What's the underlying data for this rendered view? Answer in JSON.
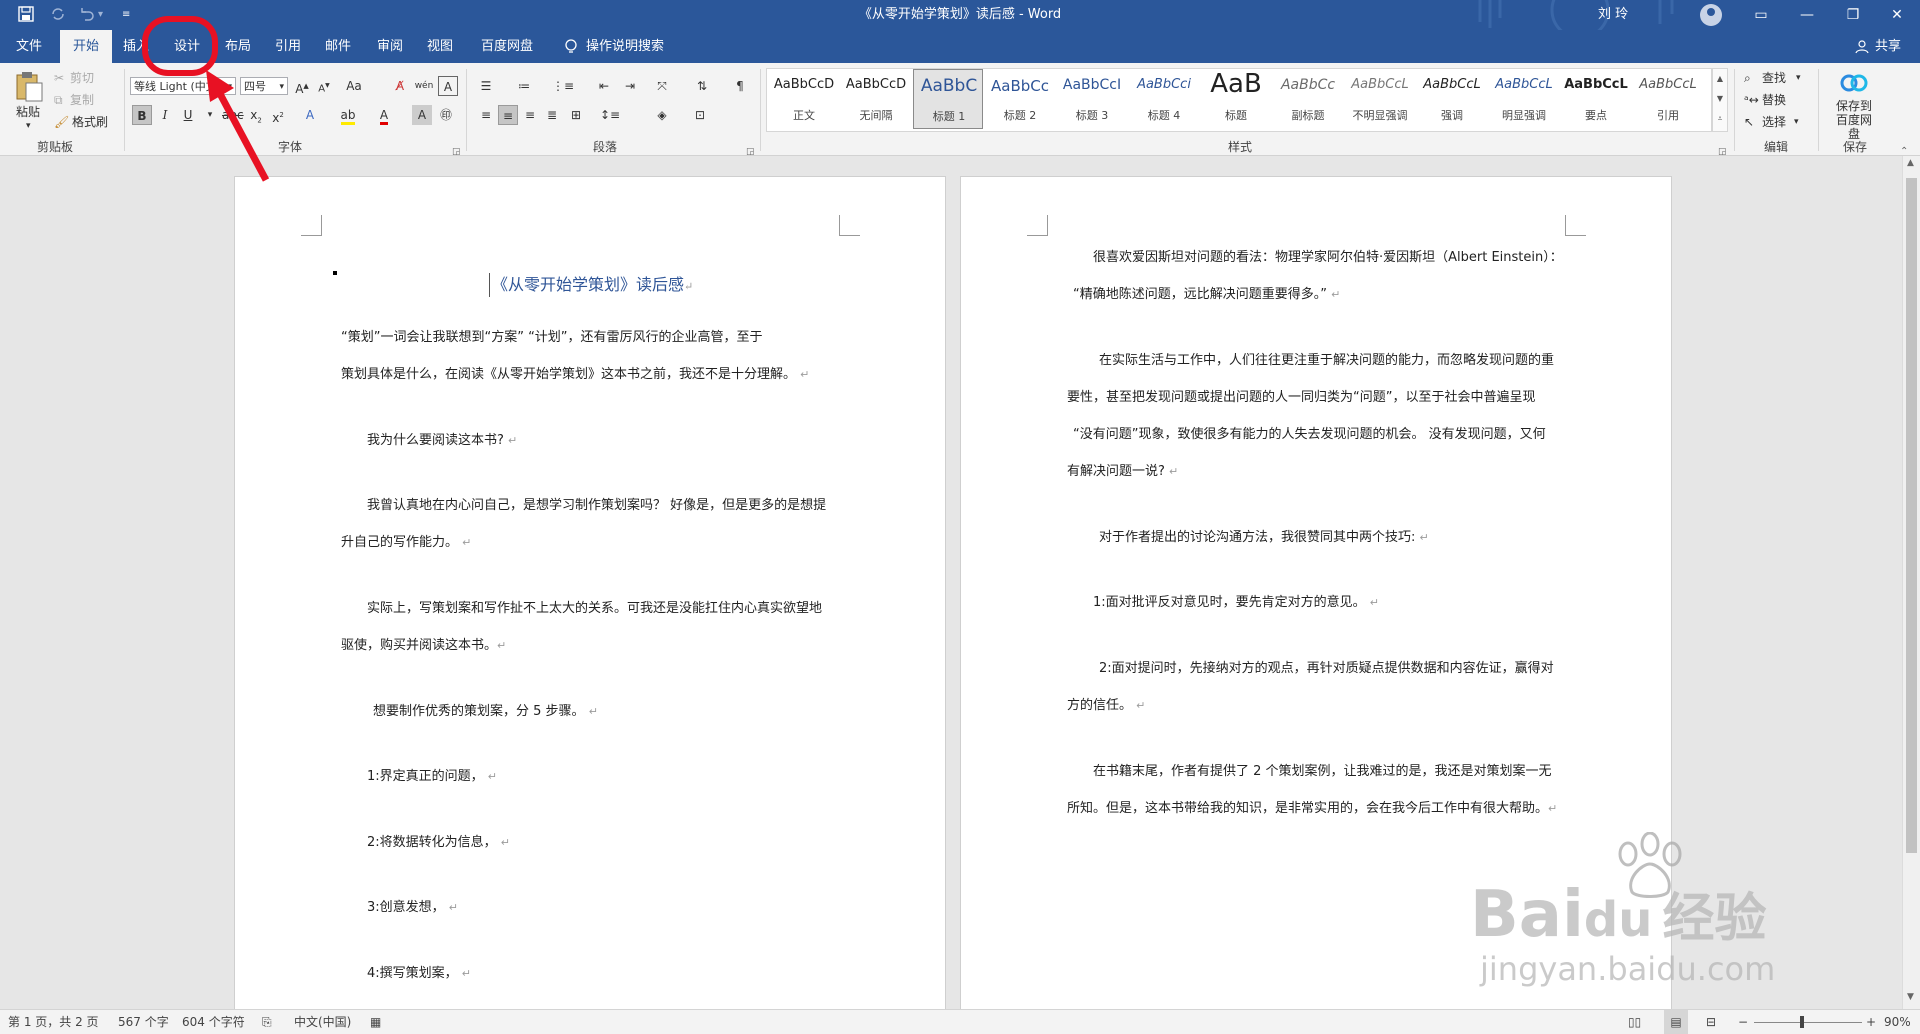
{
  "titlebar": {
    "title": "《从零开始学策划》读后感  -  Word",
    "user": "刘 玲",
    "quick_access": [
      "save-icon",
      "sync-icon",
      "undo-icon",
      "customize-icon"
    ]
  },
  "tabs": [
    "文件",
    "开始",
    "插入",
    "设计",
    "布局",
    "引用",
    "邮件",
    "审阅",
    "视图",
    "百度网盘"
  ],
  "active_tab": "开始",
  "tell_me": "操作说明搜索",
  "share": "共享",
  "clipboard": {
    "paste": "粘贴",
    "cut": "剪切",
    "copy": "复制",
    "format_painter": "格式刷",
    "label": "剪贴板"
  },
  "font": {
    "name": "等线 Light (中文",
    "size": "四号",
    "label": "字体",
    "bold": "B",
    "italic": "I",
    "underline": "U"
  },
  "paragraph": {
    "label": "段落"
  },
  "styles": {
    "label": "样式",
    "items": [
      {
        "preview": "AaBbCcD",
        "name": "正文"
      },
      {
        "preview": "AaBbCcD",
        "name": "无间隔"
      },
      {
        "preview": "AaBbC",
        "name": "标题 1"
      },
      {
        "preview": "AaBbCc",
        "name": "标题 2"
      },
      {
        "preview": "AaBbCcI",
        "name": "标题 3"
      },
      {
        "preview": "AaBbCci",
        "name": "标题 4"
      },
      {
        "preview": "AaB",
        "name": "标题"
      },
      {
        "preview": "AaBbCc",
        "name": "副标题"
      },
      {
        "preview": "AaBbCcL",
        "name": "不明显强调"
      },
      {
        "preview": "AaBbCcL",
        "name": "强调"
      },
      {
        "preview": "AaBbCcL",
        "name": "明显强调"
      },
      {
        "preview": "AaBbCcL",
        "name": "要点"
      },
      {
        "preview": "AaBbCcL",
        "name": "引用"
      }
    ],
    "selected": "标题 1"
  },
  "editing": {
    "find": "查找",
    "replace": "替换",
    "select": "选择",
    "label": "编辑"
  },
  "save": {
    "line1": "保存到",
    "line2": "百度网盘",
    "label": "保存"
  },
  "document": {
    "title": "《从零开始学策划》读后感",
    "page1": [
      "“策划”一词会让我联想到“方案” “计划”，还有雷厉风行的企业高管，至于",
      "策划具体是什么，在阅读《从零开始学策划》这本书之前，我还不是十分理解。",
      "我为什么要阅读这本书?",
      "我曾认真地在内心问自己，是想学习制作策划案吗？ 好像是，但是更多的是想提",
      "升自己的写作能力。",
      "实际上，写策划案和写作扯不上太大的关系。可我还是没能扛住内心真实欲望地",
      "驱使，购买并阅读这本书。",
      "想要制作优秀的策划案，分 5 步骤。",
      "1:界定真正的问题，",
      "2:将数据转化为信息，",
      "3:创意发想，",
      "4:撰写策划案，"
    ],
    "page2": [
      "很喜欢爱因斯坦对问题的看法：物理学家阿尔伯特·爱因斯坦（Albert Einstein）：",
      "“精确地陈述问题，远比解决问题重要得多。”",
      "在实际生活与工作中，人们往往更注重于解决问题的能力，而忽略发现问题的重",
      "要性，甚至把发现问题或提出问题的人一同归类为“问题”，以至于社会中普遍呈现",
      "“没有问题”现象，致使很多有能力的人失去发现问题的机会。 没有发现问题，又何",
      "有解决问题一说?",
      "对于作者提出的讨论沟通方法，我很赞同其中两个技巧:",
      "1:面对批评反对意见时，要先肯定对方的意见。",
      "2:面对提问时，先接纳对方的观点，再针对质疑点提供数据和内容佐证，赢得对",
      "方的信任。",
      "在书籍末尾，作者有提供了 2 个策划案例，让我难过的是，我还是对策划案一无",
      "所知。但是，这本书带给我的知识，是非常实用的，会在我今后工作中有很大帮助。"
    ]
  },
  "status": {
    "page": "第 1 页，共 2 页",
    "words": "567 个字",
    "chars": "604 个字符",
    "lang": "中文(中国)",
    "zoom": "90%"
  },
  "watermark": {
    "brand": "Bai",
    "mid": "du",
    "suffix": "经验",
    "url": "jingyan.baidu.com"
  },
  "colors": {
    "brand": "#2b579a",
    "highlight": "#e81123",
    "heading": "#2f5597"
  }
}
